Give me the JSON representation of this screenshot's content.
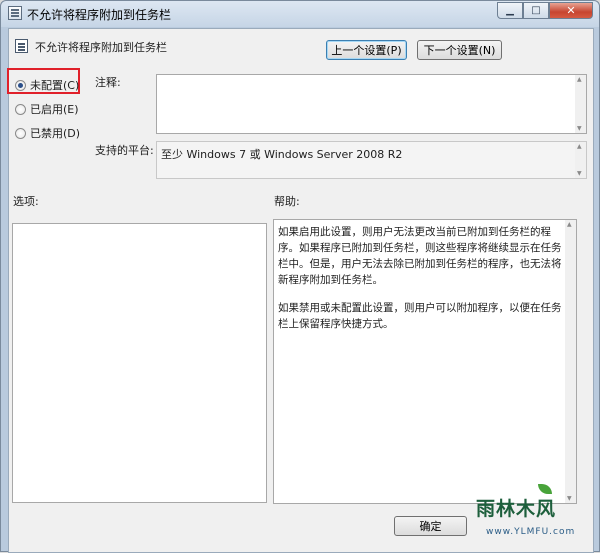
{
  "window": {
    "title": "不允许将程序附加到任务栏"
  },
  "setting": {
    "name": "不允许将程序附加到任务栏"
  },
  "nav": {
    "prev_label": "上一个设置(P)",
    "next_label": "下一个设置(N)"
  },
  "state": {
    "options": [
      {
        "label": "未配置(C)",
        "selected": true
      },
      {
        "label": "已启用(E)",
        "selected": false
      },
      {
        "label": "已禁用(D)",
        "selected": false
      }
    ]
  },
  "comment": {
    "label": "注释:",
    "value": ""
  },
  "platform": {
    "label": "支持的平台:",
    "value": "至少 Windows 7 或 Windows Server 2008 R2"
  },
  "options_section": {
    "label": "选项:"
  },
  "help_section": {
    "label": "帮助:",
    "paragraphs": [
      "如果启用此设置，则用户无法更改当前已附加到任务栏的程序。如果程序已附加到任务栏，则这些程序将继续显示在任务栏中。但是，用户无法去除已附加到任务栏的程序，也无法将新程序附加到任务栏。",
      "如果禁用或未配置此设置，则用户可以附加程序，以便在任务栏上保留程序快捷方式。"
    ]
  },
  "footer": {
    "ok_label": "确定"
  },
  "watermark": {
    "text": "雨林木风",
    "url": "www.YLMFU.com"
  },
  "colors": {
    "highlight": "#e0202a",
    "title_bg": "#c6d5e6"
  }
}
